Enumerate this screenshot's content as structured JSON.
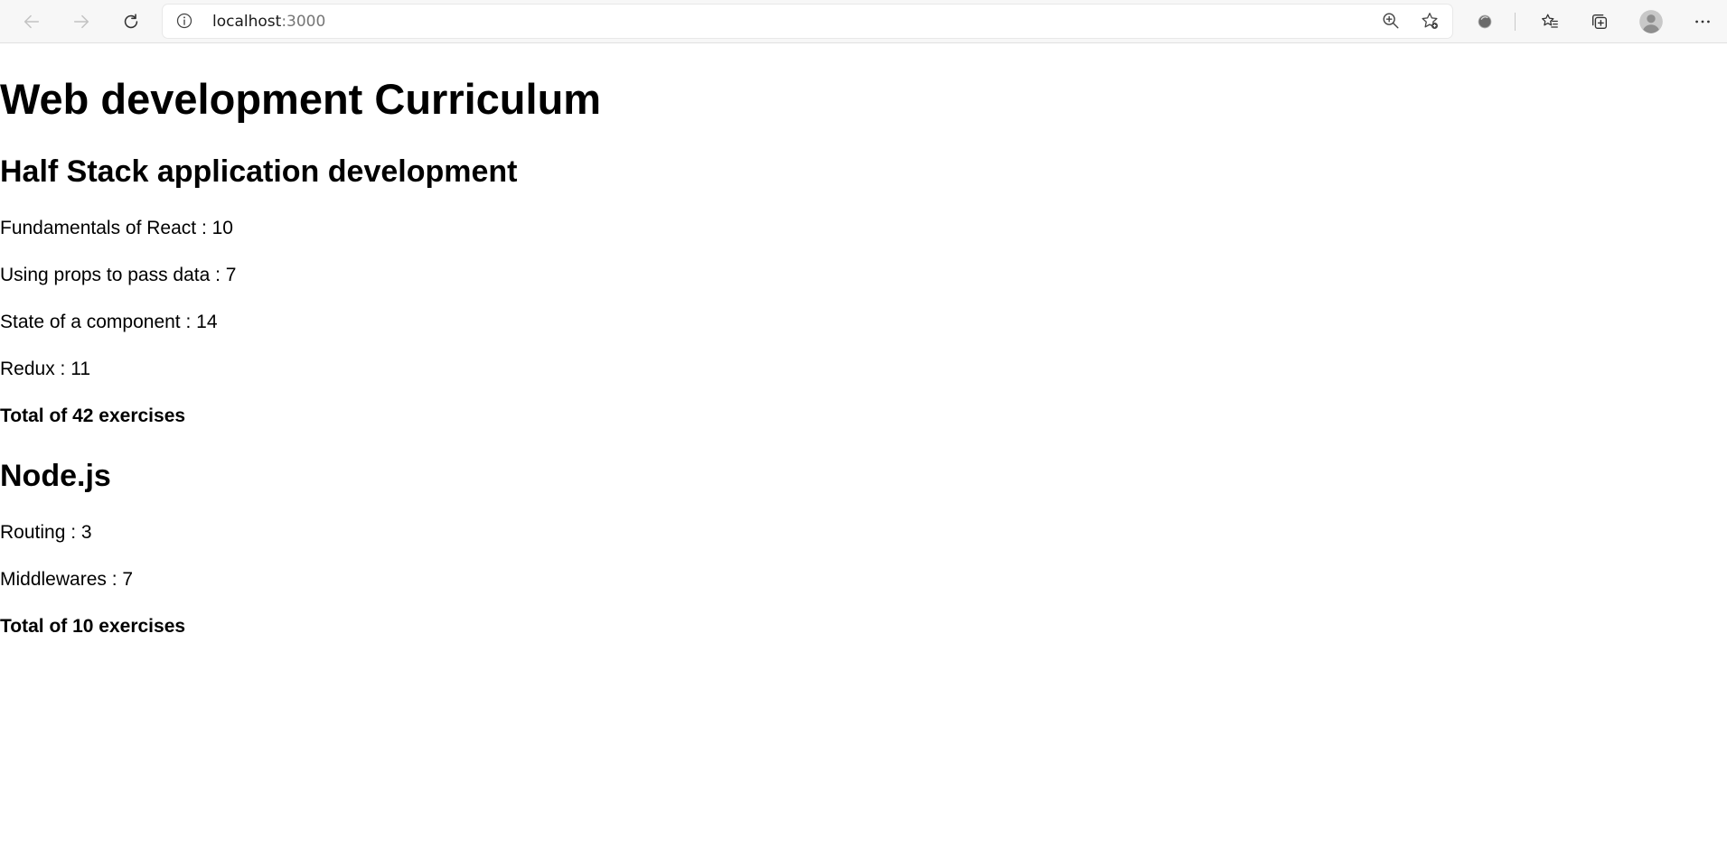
{
  "browser": {
    "url_host": "localhost",
    "url_port": ":3000",
    "icons": [
      "back-icon",
      "forward-icon",
      "refresh-icon",
      "site-info-icon",
      "zoom-icon",
      "favorite-add-icon",
      "extension-icon",
      "favorites-icon",
      "collections-icon",
      "profile-icon",
      "more-icon"
    ]
  },
  "page": {
    "title": "Web development Curriculum",
    "courses": [
      {
        "name": "Half Stack application development",
        "parts": [
          {
            "name": "Fundamentals of React",
            "exercises": 10,
            "text": "Fundamentals of React : 10"
          },
          {
            "name": "Using props to pass data",
            "exercises": 7,
            "text": "Using props to pass data : 7"
          },
          {
            "name": "State of a component",
            "exercises": 14,
            "text": "State of a component : 14"
          },
          {
            "name": "Redux",
            "exercises": 11,
            "text": "Redux : 11"
          }
        ],
        "total_text": "Total of 42 exercises"
      },
      {
        "name": "Node.js",
        "parts": [
          {
            "name": "Routing",
            "exercises": 3,
            "text": "Routing : 3"
          },
          {
            "name": "Middlewares",
            "exercises": 7,
            "text": "Middlewares : 7"
          }
        ],
        "total_text": "Total of 10 exercises"
      }
    ]
  }
}
